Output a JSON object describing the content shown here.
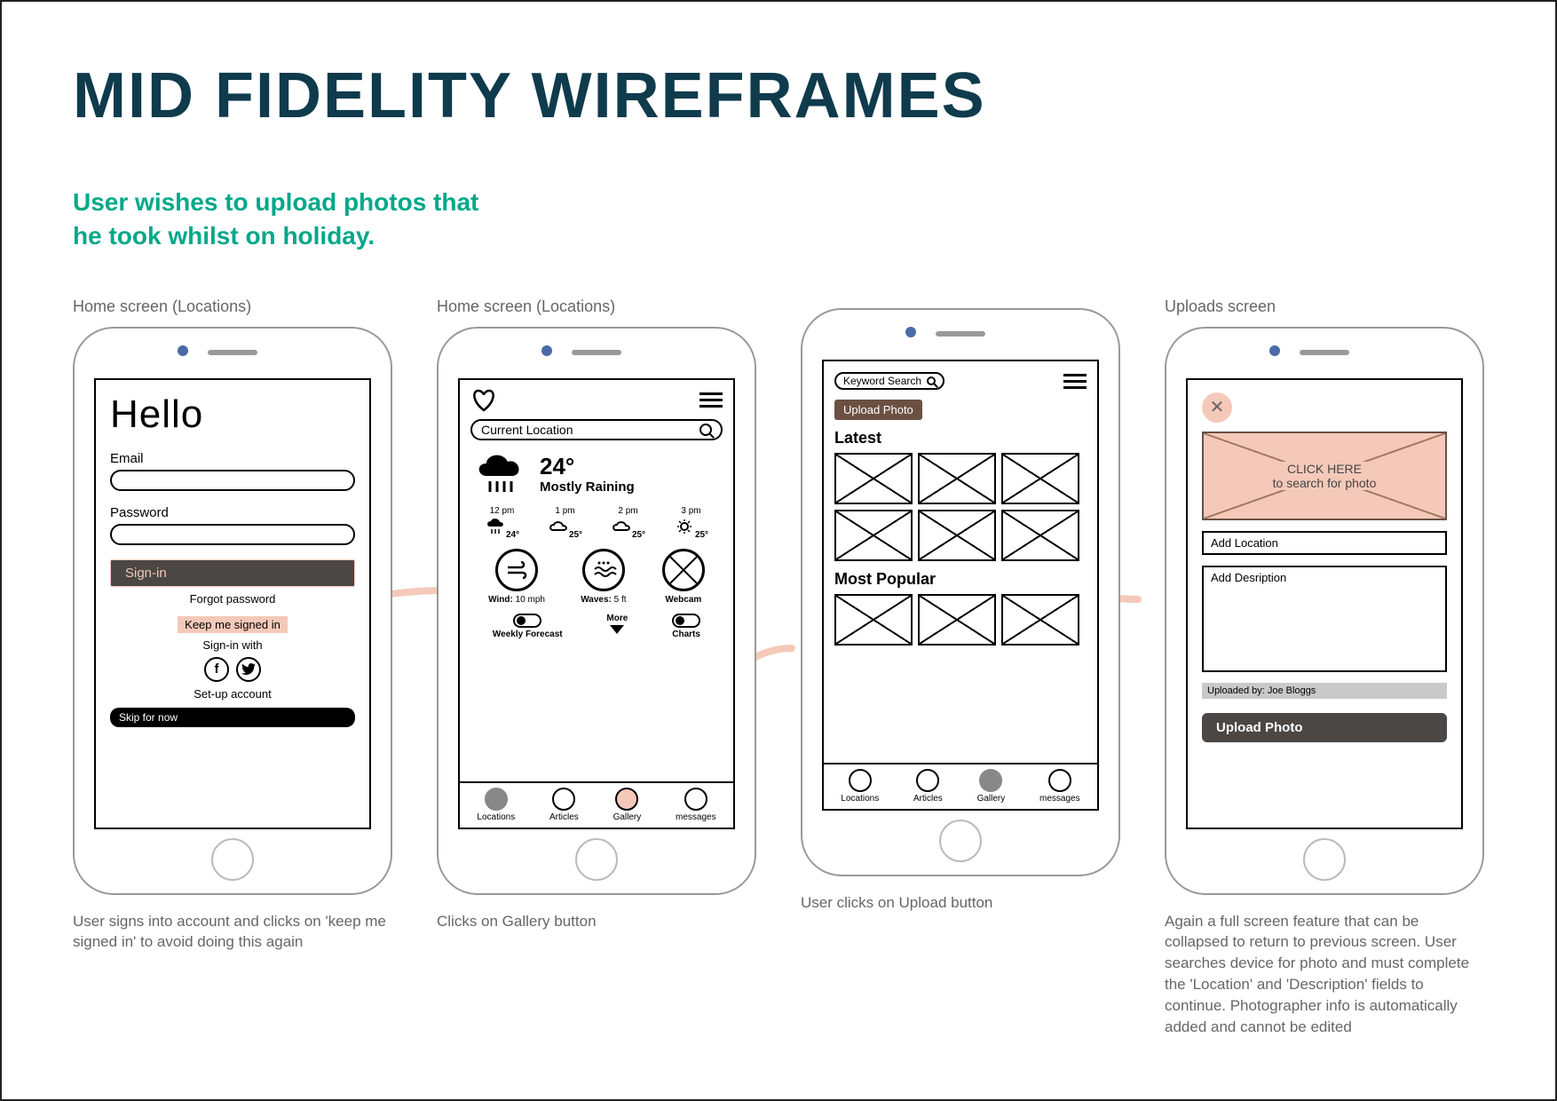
{
  "title": "MID FIDELITY WIREFRAMES",
  "subtitle_line1": "User wishes to upload photos that",
  "subtitle_line2": "he took whilst on holiday.",
  "screens": [
    {
      "label": "Home screen (Locations)",
      "caption": "User signs into account and clicks on 'keep me signed in' to avoid doing this again",
      "hello": "Hello",
      "email_label": "Email",
      "password_label": "Password",
      "signin": "Sign-in",
      "forgot": "Forgot password",
      "keep": "Keep me signed in",
      "signin_with": "Sign-in with",
      "setup": "Set-up account",
      "skip": "Skip for now"
    },
    {
      "label": "Home screen (Locations)",
      "caption": "Clicks on Gallery button",
      "search_placeholder": "Current Location",
      "temp": "24°",
      "condition": "Mostly Raining",
      "hourly": [
        {
          "time": "12 pm",
          "temp": "24°"
        },
        {
          "time": "1 pm",
          "temp": "25°"
        },
        {
          "time": "2 pm",
          "temp": "25°"
        },
        {
          "time": "3 pm",
          "temp": "25°"
        }
      ],
      "wind_label": "Wind:",
      "wind_val": "10 mph",
      "waves_label": "Waves:",
      "waves_val": "5 ft",
      "webcam": "Webcam",
      "weekly": "Weekly Forecast",
      "more": "More",
      "charts": "Charts",
      "tabs": [
        "Locations",
        "Articles",
        "Gallery",
        "messages"
      ]
    },
    {
      "label": "",
      "caption": "User clicks on Upload button",
      "keyword": "Keyword Search",
      "upload": "Upload Photo",
      "latest": "Latest",
      "popular": "Most Popular",
      "tabs": [
        "Locations",
        "Articles",
        "Gallery",
        "messages"
      ]
    },
    {
      "label": "Uploads screen",
      "caption": "Again a full screen feature that can be collapsed to return to previous screen. User searches device for photo and must complete the 'Location' and 'Description' fields to continue. Photographer info is automatically added and cannot be edited",
      "click_here": "CLICK HERE",
      "search_photo": "to search for photo",
      "add_location": "Add Location",
      "add_desc": "Add Desription",
      "uploaded_by": "Uploaded by: Joe Bloggs",
      "upload_btn": "Upload Photo"
    }
  ]
}
